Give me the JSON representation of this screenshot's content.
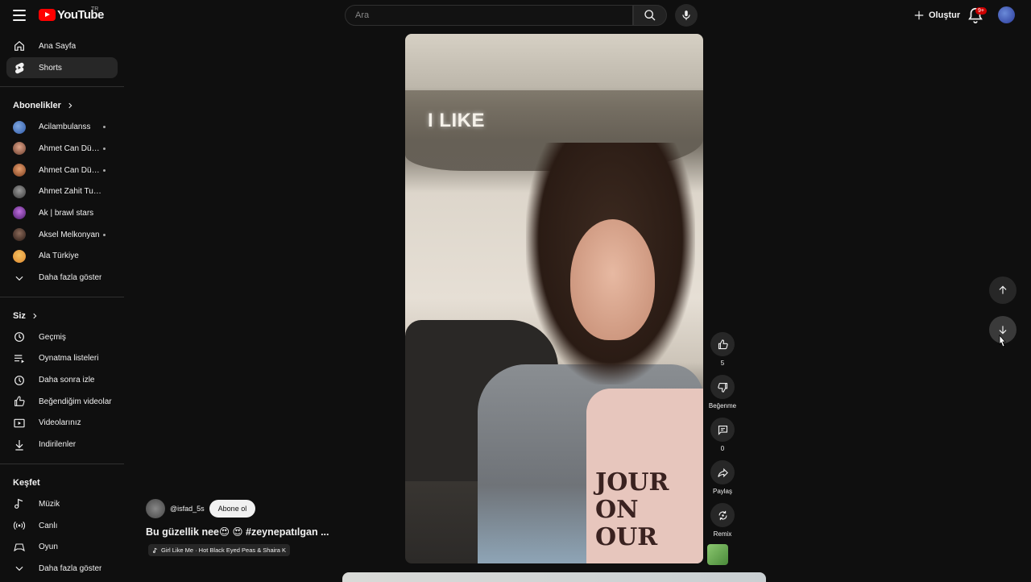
{
  "header": {
    "logo_text": "YouTube",
    "country_code": "TR",
    "search_placeholder": "Ara",
    "create_label": "Oluştur",
    "notification_count": "9+"
  },
  "sidebar": {
    "main": [
      {
        "label": "Ana Sayfa",
        "icon": "home-icon"
      },
      {
        "label": "Shorts",
        "icon": "shorts-icon",
        "active": true
      }
    ],
    "subscriptions_header": "Abonelikler",
    "subscriptions": [
      {
        "label": "Acilambulanss",
        "has_dot": true
      },
      {
        "label": "Ahmet Can Dündar",
        "has_dot": true
      },
      {
        "label": "Ahmet Can Dündar",
        "has_dot": true
      },
      {
        "label": "Ahmet Zahit Tuna",
        "has_dot": false
      },
      {
        "label": "Ak | brawl stars",
        "has_dot": false
      },
      {
        "label": "Aksel Melkonyan",
        "has_dot": true
      },
      {
        "label": "Ala Türkiye",
        "has_dot": false
      }
    ],
    "subscriptions_more": "Daha fazla göster",
    "you_header": "Siz",
    "you_items": [
      {
        "label": "Geçmiş",
        "icon": "history-icon"
      },
      {
        "label": "Oynatma listeleri",
        "icon": "playlists-icon"
      },
      {
        "label": "Daha sonra izle",
        "icon": "watch-later-icon"
      },
      {
        "label": "Beğendiğim videolar",
        "icon": "liked-videos-icon"
      },
      {
        "label": "Videolarınız",
        "icon": "your-videos-icon"
      },
      {
        "label": "İndirilenler",
        "icon": "downloads-icon"
      }
    ],
    "explore_header": "Keşfet",
    "explore_items": [
      {
        "label": "Müzik",
        "icon": "music-icon"
      },
      {
        "label": "Canlı",
        "icon": "live-icon"
      },
      {
        "label": "Oyun",
        "icon": "gaming-icon"
      }
    ],
    "explore_more": "Daha fazla göster"
  },
  "short": {
    "overlay_text": "I LIKE",
    "shirt_text": "JOUR\nON\nOUR",
    "channel_handle": "@isfad_5s",
    "subscribe_label": "Abone ol",
    "title": "Bu güzellik nee😍 😍 #zeynepatılgan ...",
    "music": "Girl Like Me · Hot Black Eyed Peas & Shaira K",
    "like_count": "5",
    "dislike_label": "Beğenme",
    "comment_count": "0",
    "share_label": "Paylaş",
    "remix_label": "Remix"
  },
  "colors": {
    "background": "#0f0f0f",
    "accent_red": "#ff0000",
    "chip": "#272727"
  }
}
